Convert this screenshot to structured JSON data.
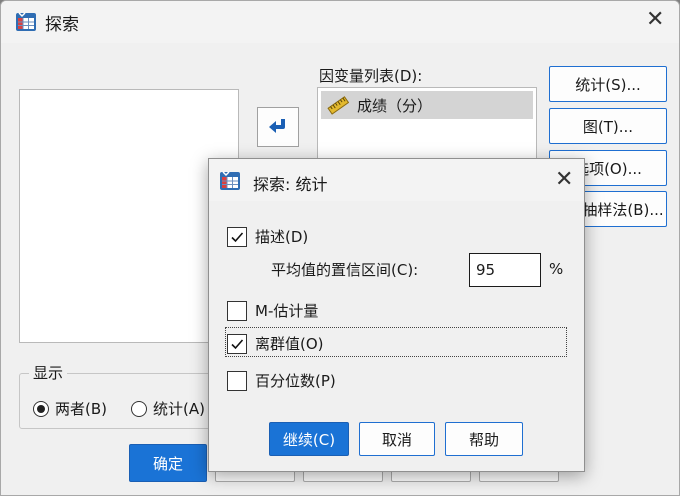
{
  "main": {
    "title": "探索",
    "dependent_label": "因变量列表(D):",
    "dependent_items": [
      {
        "label": "成绩（分）"
      }
    ],
    "right_buttons": [
      {
        "label": "统计(S)..."
      },
      {
        "label": "图(T)..."
      },
      {
        "label": "选项(O)..."
      },
      {
        "label": "自助抽样法(B)..."
      }
    ],
    "display_group": {
      "label": "显示",
      "options": [
        {
          "label": "两者(B)",
          "selected": true
        },
        {
          "label": "统计(A)",
          "selected": false
        }
      ]
    },
    "bottom_buttons": [
      {
        "label": "确定"
      }
    ]
  },
  "dialog": {
    "title": "探索: 统计",
    "descriptives": {
      "label": "描述(D)",
      "checked": true
    },
    "ci_label": "平均值的置信区间(C):",
    "ci_value": "95",
    "ci_unit": "%",
    "m_estimators": {
      "label": "M-估计量",
      "checked": false
    },
    "outliers": {
      "label": "离群值(O)",
      "checked": true
    },
    "percentiles": {
      "label": "百分位数(P)",
      "checked": false
    },
    "buttons": {
      "continue": "继续(C)",
      "cancel": "取消",
      "help": "帮助"
    }
  },
  "colors": {
    "accent": "#1a73d6",
    "selection": "#d4d4d4",
    "background": "#f0f0f0"
  },
  "icons": {
    "app": "spss-table-icon",
    "close": "close-icon",
    "move": "arrow-left-icon",
    "variable": "scale-ruler-icon",
    "check": "check-icon"
  }
}
